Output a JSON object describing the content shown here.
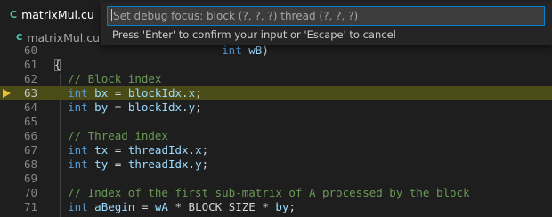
{
  "tab": {
    "title": "matrixMul.cu",
    "icon": "cuda-file-icon"
  },
  "breadcrumb": {
    "file": "matrixMul.cu",
    "separator": "›"
  },
  "editor": {
    "current_line": 63,
    "lines": [
      {
        "number": "60",
        "tokens": [
          {
            "t": "                         "
          },
          {
            "t": "int",
            "c": "kw"
          },
          {
            "t": " "
          },
          {
            "t": "wB",
            "c": "var"
          },
          {
            "t": ")"
          }
        ]
      },
      {
        "number": "61",
        "tokens": [
          {
            "t": "{"
          }
        ]
      },
      {
        "number": "62",
        "tokens": [
          {
            "t": "  "
          },
          {
            "t": "// Block index",
            "c": "cmt"
          }
        ]
      },
      {
        "number": "63",
        "tokens": [
          {
            "t": "  "
          },
          {
            "t": "int",
            "c": "kw"
          },
          {
            "t": " "
          },
          {
            "t": "bx",
            "c": "var"
          },
          {
            "t": " = "
          },
          {
            "t": "blockIdx",
            "c": "var"
          },
          {
            "t": "."
          },
          {
            "t": "x",
            "c": "var"
          },
          {
            "t": ";"
          }
        ]
      },
      {
        "number": "64",
        "tokens": [
          {
            "t": "  "
          },
          {
            "t": "int",
            "c": "kw"
          },
          {
            "t": " "
          },
          {
            "t": "by",
            "c": "var"
          },
          {
            "t": " = "
          },
          {
            "t": "blockIdx",
            "c": "var"
          },
          {
            "t": "."
          },
          {
            "t": "y",
            "c": "var"
          },
          {
            "t": ";"
          }
        ]
      },
      {
        "number": "65",
        "tokens": []
      },
      {
        "number": "66",
        "tokens": [
          {
            "t": "  "
          },
          {
            "t": "// Thread index",
            "c": "cmt"
          }
        ]
      },
      {
        "number": "67",
        "tokens": [
          {
            "t": "  "
          },
          {
            "t": "int",
            "c": "kw"
          },
          {
            "t": " "
          },
          {
            "t": "tx",
            "c": "var"
          },
          {
            "t": " = "
          },
          {
            "t": "threadIdx",
            "c": "var"
          },
          {
            "t": "."
          },
          {
            "t": "x",
            "c": "var"
          },
          {
            "t": ";"
          }
        ]
      },
      {
        "number": "68",
        "tokens": [
          {
            "t": "  "
          },
          {
            "t": "int",
            "c": "kw"
          },
          {
            "t": " "
          },
          {
            "t": "ty",
            "c": "var"
          },
          {
            "t": " = "
          },
          {
            "t": "threadIdx",
            "c": "var"
          },
          {
            "t": "."
          },
          {
            "t": "y",
            "c": "var"
          },
          {
            "t": ";"
          }
        ]
      },
      {
        "number": "69",
        "tokens": []
      },
      {
        "number": "70",
        "tokens": [
          {
            "t": "  "
          },
          {
            "t": "// Index of the first sub-matrix of A processed by the block",
            "c": "cmt"
          }
        ]
      },
      {
        "number": "71",
        "tokens": [
          {
            "t": "  "
          },
          {
            "t": "int",
            "c": "kw"
          },
          {
            "t": " "
          },
          {
            "t": "aBegin",
            "c": "var"
          },
          {
            "t": " = "
          },
          {
            "t": "wA",
            "c": "var"
          },
          {
            "t": " * BLOCK_SIZE * "
          },
          {
            "t": "by",
            "c": "var"
          },
          {
            "t": ";"
          }
        ]
      }
    ]
  },
  "quick_input": {
    "placeholder": "Set debug focus: block (?, ?, ?) thread (?, ?, ?)",
    "value": "",
    "message": "Press 'Enter' to confirm your input or 'Escape' to cancel"
  },
  "colors": {
    "editor_bg": "#1e1e1e",
    "current_line_bg": "#4b4b18",
    "input_focus_border": "#007fd4",
    "keyword": "#569cd6",
    "variable": "#9cdcfe",
    "comment": "#6a9955",
    "breakpoint_arrow": "#e7c13e"
  }
}
